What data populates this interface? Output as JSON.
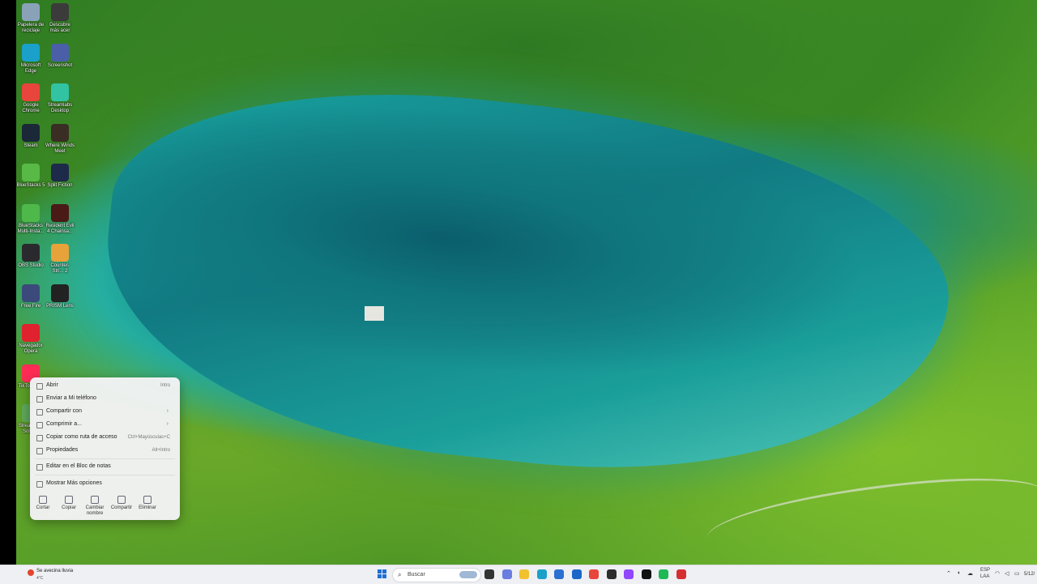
{
  "desktop_icons": [
    {
      "label": "Papelera de reciclaje",
      "icon": "recycle-bin-icon",
      "color": "#8aa2b8"
    },
    {
      "label": "Descubre más acer",
      "icon": "acer-discover-icon",
      "color": "#3b3b3b"
    },
    {
      "label": "Microsoft Edge",
      "icon": "edge-icon",
      "color": "#1aa0c9"
    },
    {
      "label": "Screenshot",
      "icon": "screenshot-icon",
      "color": "#4a5fa8"
    },
    {
      "label": "Google Chrome",
      "icon": "chrome-icon",
      "color": "#e8453c"
    },
    {
      "label": "Streamlabs Desktop",
      "icon": "streamlabs-icon",
      "color": "#31c3a2"
    },
    {
      "label": "Steam",
      "icon": "steam-icon",
      "color": "#1b2838"
    },
    {
      "label": "Where Winds Meet",
      "icon": "where-winds-meet-icon",
      "color": "#3a2e24"
    },
    {
      "label": "BlueStacks 5",
      "icon": "bluestacks-icon",
      "color": "#58b947"
    },
    {
      "label": "Split Fiction",
      "icon": "split-fiction-icon",
      "color": "#1e2a4a"
    },
    {
      "label": "BlueStacks Multi-Insta...",
      "icon": "bluestacks-multi-icon",
      "color": "#4fb84a"
    },
    {
      "label": "Resident Evil 4 Chainsa...",
      "icon": "resident-evil-icon",
      "color": "#4a1a16"
    },
    {
      "label": "OBS Studio",
      "icon": "obs-icon",
      "color": "#2a2a2e"
    },
    {
      "label": "Counter-Stri... 2",
      "icon": "counter-strike-icon",
      "color": "#e8a23a"
    },
    {
      "label": "Free Fire",
      "icon": "free-fire-icon",
      "color": "#3b4a7a"
    },
    {
      "label": "PRISM Lens",
      "icon": "prism-lens-icon",
      "color": "#222222"
    },
    {
      "label": "Navegador Opera",
      "icon": "opera-icon",
      "color": "#e0212e"
    },
    {
      "label": "TikTok Sti...",
      "icon": "tiktok-icon",
      "color": "#fe2c55"
    },
    {
      "label": "Streamlabs Soluti...",
      "icon": "streamlabs-alt-icon",
      "color": "#5fa85a"
    }
  ],
  "context_menu": {
    "items": [
      {
        "label": "Abrir",
        "shortcut": "Intro",
        "icon": "open-icon"
      },
      {
        "label": "Enviar a Mi teléfono",
        "shortcut": "",
        "icon": "phone-icon"
      },
      {
        "label": "Compartir con",
        "shortcut": "",
        "icon": "share-with-icon",
        "submenu": true
      },
      {
        "label": "Comprimir a...",
        "shortcut": "",
        "icon": "compress-icon",
        "submenu": true
      },
      {
        "label": "Copiar como ruta de acceso",
        "shortcut": "Ctrl+Mayúsculas+C",
        "icon": "copy-path-icon"
      },
      {
        "label": "Propiedades",
        "shortcut": "Alt+Intro",
        "icon": "properties-icon"
      },
      {
        "label": "Editar en el Bloc de notas",
        "shortcut": "",
        "icon": "notepad-icon"
      },
      {
        "label": "Mostrar Más opciones",
        "shortcut": "",
        "icon": "more-options-icon"
      }
    ],
    "actions": [
      {
        "label": "Cortar",
        "icon": "cut-icon"
      },
      {
        "label": "Copiar",
        "icon": "copy-icon"
      },
      {
        "label": "Cambiar nombre",
        "icon": "rename-icon"
      },
      {
        "label": "Compartir",
        "icon": "share-icon"
      },
      {
        "label": "Eliminar",
        "icon": "delete-icon"
      }
    ]
  },
  "taskbar": {
    "weather_title": "Se avecina lluvia",
    "weather_temp": "4°C",
    "search_placeholder": "Buscar",
    "apps": [
      {
        "icon": "task-view-icon",
        "color": "#333333"
      },
      {
        "icon": "copilot-icon",
        "color": "#6a7de0"
      },
      {
        "icon": "file-explorer-icon",
        "color": "#f2c12e"
      },
      {
        "icon": "edge-icon",
        "color": "#1aa0c9"
      },
      {
        "icon": "store-icon",
        "color": "#2b6fd1"
      },
      {
        "icon": "mail-icon",
        "color": "#1a66c9"
      },
      {
        "icon": "chrome-icon",
        "color": "#e8453c"
      },
      {
        "icon": "terminal-icon",
        "color": "#2c2c2c"
      },
      {
        "icon": "twitch-icon",
        "color": "#9146ff"
      },
      {
        "icon": "tiktok-icon",
        "color": "#111111"
      },
      {
        "icon": "spotify-icon",
        "color": "#1db954"
      },
      {
        "icon": "record-icon",
        "color": "#d62f2f"
      }
    ],
    "language": "ESP",
    "keyboard": "LAA",
    "date": "5/12/"
  },
  "accent_color": "#1f6fd6"
}
